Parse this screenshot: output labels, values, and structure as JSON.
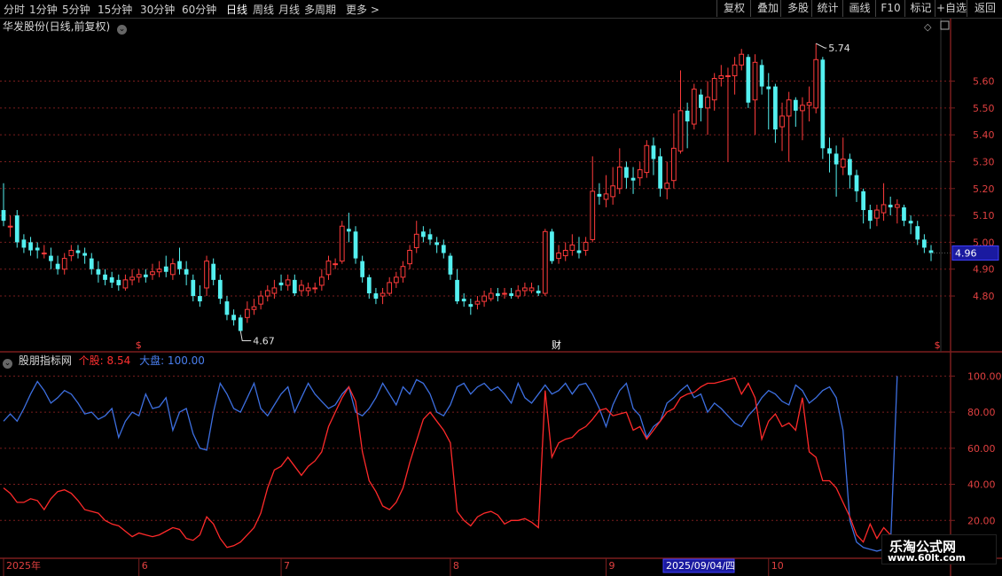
{
  "toolbar": {
    "periods": [
      {
        "label": "分时"
      },
      {
        "label": "1分钟"
      },
      {
        "label": "5分钟"
      },
      {
        "label": "15分钟"
      },
      {
        "label": "30分钟"
      },
      {
        "label": "60分钟"
      },
      {
        "label": "日线",
        "active": true
      },
      {
        "label": "周线"
      },
      {
        "label": "月线"
      },
      {
        "label": "多周期"
      },
      {
        "label": "更多 >"
      }
    ],
    "right_buttons": [
      {
        "label": "复权"
      },
      {
        "label": "叠加"
      },
      {
        "label": "多股"
      },
      {
        "label": "统计"
      },
      {
        "label": "画线"
      },
      {
        "label": "F10"
      },
      {
        "label": "标记"
      },
      {
        "label": "+自选"
      },
      {
        "label": "返回"
      }
    ]
  },
  "stock_title": "华发股份(日线,前复权)",
  "indicator": {
    "name": "股朋指标网",
    "series1_label": "个股: 8.54",
    "series2_label": "大盘: 100.00"
  },
  "price_axis": {
    "ticks": [
      "5.60",
      "5.50",
      "5.40",
      "5.30",
      "5.20",
      "5.10",
      "5.00",
      "4.90",
      "4.80"
    ],
    "current_price": "4.96"
  },
  "indicator_axis": {
    "ticks": [
      "100.00",
      "80.00",
      "60.00",
      "40.00",
      "20.00"
    ]
  },
  "annotations": {
    "high": "5.74",
    "low": "4.67",
    "fin_marker": "财"
  },
  "date_axis": {
    "labels": [
      {
        "text": "2025年",
        "idx": 0
      },
      {
        "text": "6",
        "idx": 20
      },
      {
        "text": "7",
        "idx": 41
      },
      {
        "text": "8",
        "idx": 66
      },
      {
        "text": "9",
        "idx": 89
      },
      {
        "text": "10",
        "idx": 113
      }
    ],
    "cursor_date": "2025/09/04/四"
  },
  "watermark": {
    "line1": "乐淘公式网",
    "line2": "www.60lt.com"
  },
  "colors": {
    "up": "#ff3b3b",
    "down": "#54f0f0",
    "individual": "#ff2a2a",
    "market": "#3d6fe0",
    "grid": "#7a1e1e"
  },
  "chart_data": {
    "type": "candlestick",
    "price_range": [
      4.6,
      5.8
    ],
    "candles": [
      [
        5.12,
        5.08,
        5.22,
        5.06
      ],
      [
        5.06,
        5.06,
        5.1,
        5.02
      ],
      [
        5.1,
        5.0,
        5.12,
        4.98
      ],
      [
        5.01,
        4.98,
        5.03,
        4.96
      ],
      [
        5.0,
        4.97,
        5.02,
        4.95
      ],
      [
        4.98,
        4.97,
        5.0,
        4.94
      ],
      [
        4.96,
        4.96,
        4.99,
        4.94
      ],
      [
        4.95,
        4.93,
        4.98,
        4.9
      ],
      [
        4.92,
        4.9,
        4.95,
        4.88
      ],
      [
        4.9,
        4.94,
        4.96,
        4.88
      ],
      [
        4.95,
        4.97,
        4.99,
        4.93
      ],
      [
        4.97,
        4.96,
        4.99,
        4.94
      ],
      [
        4.96,
        4.95,
        4.98,
        4.92
      ],
      [
        4.94,
        4.9,
        4.96,
        4.88
      ],
      [
        4.9,
        4.88,
        4.93,
        4.85
      ],
      [
        4.88,
        4.86,
        4.9,
        4.84
      ],
      [
        4.87,
        4.85,
        4.89,
        4.83
      ],
      [
        4.86,
        4.84,
        4.88,
        4.82
      ],
      [
        4.83,
        4.86,
        4.88,
        4.82
      ],
      [
        4.86,
        4.87,
        4.9,
        4.84
      ],
      [
        4.87,
        4.88,
        4.9,
        4.85
      ],
      [
        4.88,
        4.87,
        4.9,
        4.85
      ],
      [
        4.88,
        4.89,
        4.92,
        4.86
      ],
      [
        4.89,
        4.9,
        4.93,
        4.87
      ],
      [
        4.91,
        4.89,
        4.95,
        4.87
      ],
      [
        4.88,
        4.92,
        4.94,
        4.86
      ],
      [
        4.93,
        4.9,
        4.98,
        4.88
      ],
      [
        4.9,
        4.88,
        4.93,
        4.84
      ],
      [
        4.86,
        4.8,
        4.88,
        4.78
      ],
      [
        4.8,
        4.78,
        4.84,
        4.76
      ],
      [
        4.83,
        4.93,
        4.95,
        4.8
      ],
      [
        4.92,
        4.86,
        4.94,
        4.84
      ],
      [
        4.86,
        4.79,
        4.88,
        4.77
      ],
      [
        4.78,
        4.73,
        4.8,
        4.71
      ],
      [
        4.73,
        4.71,
        4.75,
        4.69
      ],
      [
        4.72,
        4.67,
        4.73,
        4.67
      ],
      [
        4.72,
        4.75,
        4.78,
        4.7
      ],
      [
        4.75,
        4.76,
        4.79,
        4.73
      ],
      [
        4.77,
        4.8,
        4.82,
        4.75
      ],
      [
        4.8,
        4.82,
        4.84,
        4.78
      ],
      [
        4.81,
        4.83,
        4.86,
        4.79
      ],
      [
        4.85,
        4.84,
        4.88,
        4.82
      ],
      [
        4.84,
        4.86,
        4.88,
        4.82
      ],
      [
        4.86,
        4.81,
        4.88,
        4.8
      ],
      [
        4.82,
        4.84,
        4.86,
        4.8
      ],
      [
        4.82,
        4.83,
        4.85,
        4.8
      ],
      [
        4.83,
        4.83,
        4.85,
        4.81
      ],
      [
        4.84,
        4.87,
        4.9,
        4.82
      ],
      [
        4.88,
        4.93,
        4.95,
        4.86
      ],
      [
        4.92,
        4.92,
        4.94,
        4.9
      ],
      [
        4.93,
        5.06,
        5.08,
        4.92
      ],
      [
        5.05,
        5.04,
        5.11,
        5.0
      ],
      [
        5.04,
        4.94,
        5.06,
        4.92
      ],
      [
        4.93,
        4.87,
        4.95,
        4.85
      ],
      [
        4.87,
        4.81,
        4.88,
        4.79
      ],
      [
        4.81,
        4.79,
        4.83,
        4.77
      ],
      [
        4.8,
        4.81,
        4.83,
        4.77
      ],
      [
        4.81,
        4.85,
        4.87,
        4.8
      ],
      [
        4.85,
        4.87,
        4.89,
        4.83
      ],
      [
        4.87,
        4.91,
        4.93,
        4.85
      ],
      [
        4.92,
        4.97,
        4.99,
        4.9
      ],
      [
        4.98,
        5.03,
        5.08,
        4.96
      ],
      [
        5.04,
        5.02,
        5.06,
        5.0
      ],
      [
        5.03,
        5.01,
        5.05,
        4.99
      ],
      [
        5.0,
        4.99,
        5.02,
        4.96
      ],
      [
        4.99,
        4.96,
        5.01,
        4.94
      ],
      [
        4.95,
        4.88,
        4.96,
        4.86
      ],
      [
        4.86,
        4.78,
        4.9,
        4.77
      ],
      [
        4.79,
        4.78,
        4.81,
        4.76
      ],
      [
        4.77,
        4.76,
        4.79,
        4.73
      ],
      [
        4.77,
        4.78,
        4.8,
        4.75
      ],
      [
        4.78,
        4.8,
        4.82,
        4.76
      ],
      [
        4.79,
        4.81,
        4.83,
        4.78
      ],
      [
        4.81,
        4.8,
        4.83,
        4.78
      ],
      [
        4.81,
        4.81,
        4.83,
        4.79
      ],
      [
        4.81,
        4.8,
        4.83,
        4.79
      ],
      [
        4.8,
        4.82,
        4.84,
        4.79
      ],
      [
        4.82,
        4.83,
        4.85,
        4.8
      ],
      [
        4.82,
        4.83,
        4.85,
        4.81
      ],
      [
        4.82,
        4.81,
        4.84,
        4.8
      ],
      [
        4.81,
        5.04,
        5.05,
        4.8
      ],
      [
        5.04,
        4.93,
        5.05,
        4.92
      ],
      [
        4.94,
        4.96,
        4.99,
        4.92
      ],
      [
        4.95,
        4.97,
        5.0,
        4.93
      ],
      [
        4.97,
        4.99,
        5.03,
        4.95
      ],
      [
        4.97,
        4.96,
        5.02,
        4.94
      ],
      [
        4.97,
        5.0,
        5.02,
        4.95
      ],
      [
        5.01,
        5.19,
        5.32,
        5.0
      ],
      [
        5.18,
        5.17,
        5.22,
        5.14
      ],
      [
        5.16,
        5.18,
        5.25,
        5.13
      ],
      [
        5.17,
        5.21,
        5.28,
        5.14
      ],
      [
        5.2,
        5.28,
        5.35,
        5.18
      ],
      [
        5.28,
        5.24,
        5.3,
        5.2
      ],
      [
        5.24,
        5.23,
        5.28,
        5.18
      ],
      [
        5.24,
        5.27,
        5.3,
        5.21
      ],
      [
        5.26,
        5.36,
        5.38,
        5.24
      ],
      [
        5.36,
        5.31,
        5.39,
        5.25
      ],
      [
        5.32,
        5.2,
        5.35,
        5.17
      ],
      [
        5.2,
        5.22,
        5.3,
        5.16
      ],
      [
        5.23,
        5.35,
        5.48,
        5.2
      ],
      [
        5.34,
        5.49,
        5.64,
        5.33
      ],
      [
        5.49,
        5.45,
        5.52,
        5.35
      ],
      [
        5.44,
        5.57,
        5.59,
        5.42
      ],
      [
        5.55,
        5.5,
        5.57,
        5.45
      ],
      [
        5.5,
        5.54,
        5.6,
        5.4
      ],
      [
        5.53,
        5.61,
        5.63,
        5.49
      ],
      [
        5.61,
        5.62,
        5.66,
        5.58
      ],
      [
        5.62,
        5.62,
        5.65,
        5.3
      ],
      [
        5.62,
        5.66,
        5.69,
        5.55
      ],
      [
        5.66,
        5.7,
        5.72,
        5.64
      ],
      [
        5.69,
        5.52,
        5.7,
        5.5
      ],
      [
        5.53,
        5.67,
        5.7,
        5.4
      ],
      [
        5.66,
        5.58,
        5.68,
        5.55
      ],
      [
        5.58,
        5.57,
        5.63,
        5.42
      ],
      [
        5.58,
        5.42,
        5.59,
        5.37
      ],
      [
        5.43,
        5.47,
        5.52,
        5.34
      ],
      [
        5.47,
        5.53,
        5.56,
        5.3
      ],
      [
        5.53,
        5.49,
        5.54,
        5.43
      ],
      [
        5.49,
        5.51,
        5.54,
        5.38
      ],
      [
        5.51,
        5.52,
        5.58,
        5.45
      ],
      [
        5.5,
        5.68,
        5.74,
        5.48
      ],
      [
        5.68,
        5.35,
        5.69,
        5.31
      ],
      [
        5.35,
        5.33,
        5.39,
        5.26
      ],
      [
        5.33,
        5.29,
        5.36,
        5.17
      ],
      [
        5.28,
        5.31,
        5.39,
        5.25
      ],
      [
        5.31,
        5.25,
        5.33,
        5.2
      ],
      [
        5.25,
        5.19,
        5.27,
        5.15
      ],
      [
        5.19,
        5.12,
        5.2,
        5.07
      ],
      [
        5.12,
        5.08,
        5.14,
        5.05
      ],
      [
        5.09,
        5.12,
        5.14,
        5.06
      ],
      [
        5.11,
        5.14,
        5.22,
        5.08
      ],
      [
        5.14,
        5.13,
        5.17,
        5.1
      ],
      [
        5.13,
        5.14,
        5.16,
        5.07
      ],
      [
        5.13,
        5.08,
        5.14,
        5.06
      ],
      [
        5.08,
        5.07,
        5.1,
        5.03
      ],
      [
        5.06,
        5.01,
        5.08,
        4.99
      ],
      [
        5.01,
        4.98,
        5.03,
        4.96
      ],
      [
        4.97,
        4.96,
        4.99,
        4.93
      ]
    ],
    "indicator_range": [
      0,
      110
    ],
    "individual": [
      38,
      35,
      30,
      30,
      32,
      31,
      26,
      32,
      36,
      37,
      35,
      31,
      26,
      25,
      24,
      20,
      18,
      17,
      14,
      11,
      13,
      12,
      11,
      12,
      14,
      16,
      15,
      10,
      9,
      12,
      22,
      18,
      10,
      5,
      6,
      8,
      12,
      16,
      24,
      38,
      48,
      50,
      55,
      50,
      45,
      50,
      53,
      58,
      72,
      80,
      88,
      94,
      86,
      58,
      42,
      36,
      28,
      26,
      30,
      38,
      52,
      64,
      76,
      80,
      75,
      70,
      63,
      25,
      20,
      17,
      22,
      24,
      25,
      23,
      18,
      20,
      20,
      21,
      19,
      16,
      92,
      55,
      63,
      65,
      66,
      70,
      72,
      76,
      81,
      82,
      78,
      79,
      80,
      70,
      72,
      65,
      70,
      75,
      80,
      82,
      88,
      90,
      91,
      94,
      96,
      96,
      97,
      98,
      99,
      90,
      96,
      88,
      65,
      75,
      79,
      72,
      74,
      70,
      88,
      58,
      55,
      42,
      42,
      38,
      30,
      22,
      12,
      8,
      18,
      10,
      16,
      12,
      10,
      10
    ],
    "market": [
      75,
      79,
      75,
      82,
      90,
      97,
      92,
      85,
      88,
      92,
      90,
      85,
      79,
      80,
      76,
      78,
      82,
      66,
      75,
      80,
      78,
      90,
      82,
      83,
      88,
      70,
      80,
      82,
      68,
      60,
      59,
      80,
      96,
      90,
      82,
      80,
      88,
      96,
      82,
      78,
      84,
      90,
      94,
      80,
      88,
      96,
      90,
      86,
      82,
      84,
      90,
      94,
      80,
      78,
      82,
      88,
      96,
      90,
      84,
      94,
      90,
      98,
      96,
      90,
      80,
      78,
      84,
      94,
      96,
      90,
      94,
      96,
      92,
      94,
      90,
      85,
      96,
      88,
      85,
      90,
      95,
      90,
      92,
      96,
      90,
      95,
      96,
      90,
      82,
      72,
      84,
      92,
      96,
      82,
      78,
      66,
      72,
      75,
      85,
      88,
      92,
      95,
      88,
      90,
      80,
      85,
      82,
      78,
      74,
      72,
      78,
      82,
      88,
      92,
      90,
      86,
      84,
      95,
      92,
      85,
      88,
      92,
      94,
      88,
      70,
      20,
      8,
      5,
      4,
      3,
      4,
      5,
      100
    ]
  }
}
